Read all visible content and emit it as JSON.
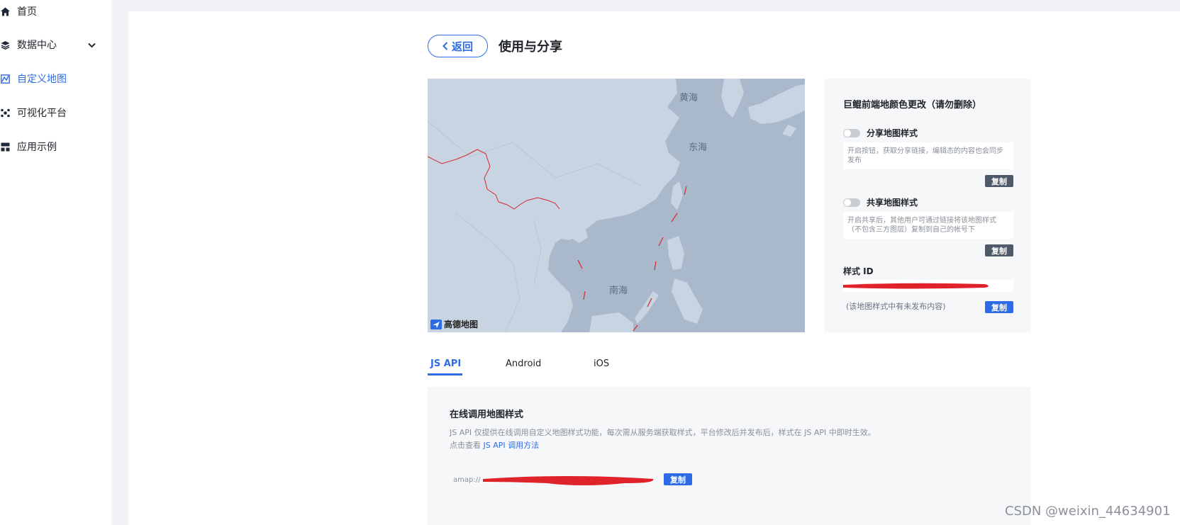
{
  "sidebar": {
    "items": [
      {
        "label": "首页",
        "icon": "home-icon"
      },
      {
        "label": "数据中心",
        "icon": "layers-icon"
      },
      {
        "label": "自定义地图",
        "icon": "custom-map-icon"
      },
      {
        "label": "可视化平台",
        "icon": "visualization-icon"
      },
      {
        "label": "应用示例",
        "icon": "examples-icon"
      }
    ],
    "active_item": "自定义地图",
    "accent_color": "#2d6ce6"
  },
  "header": {
    "back_label": "返回",
    "title": "使用与分享"
  },
  "map": {
    "labels": {
      "yellow_sea": "黄海",
      "east_sea": "东海",
      "south_sea": "南海"
    },
    "logo_text": "高德地图"
  },
  "panel": {
    "title": "巨鲲前端地颜色更改（请勿删除）",
    "share_toggle_label": "分享地图样式",
    "share_desc": "开启按钮，获取分享链接，编辑态的内容也会同步发布",
    "share_copy": "复制",
    "common_toggle_label": "共享地图样式",
    "common_desc": "开启共享后，其他用户可通过链接将该地图样式（不包含三方图层）复制到自己的帐号下",
    "common_copy": "复制",
    "style_id_label": "样式 ID",
    "unpublished_note": "(该地图样式中有未发布内容)",
    "style_id_copy": "复制"
  },
  "tabs": [
    {
      "label": "JS API",
      "active": true
    },
    {
      "label": "Android",
      "active": false
    },
    {
      "label": "iOS",
      "active": false
    }
  ],
  "online": {
    "title": "在线调用地图样式",
    "desc_line1": "JS API 仅提供在线调用自定义地图样式功能，每次需从服务端获取样式，平台修改后并发布后，样式在 JS API 中即时生效。",
    "desc_line2_prefix": "点击查看",
    "desc_link": "JS API 调用方法",
    "url_prefix": "amap://",
    "copy_label": "复制"
  },
  "watermark": "CSDN @weixin_44634901"
}
